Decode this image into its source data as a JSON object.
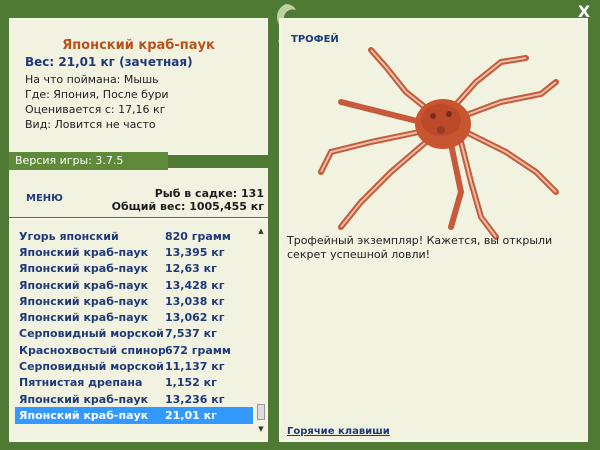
{
  "header": {
    "close_label": "X"
  },
  "catch": {
    "title": "Японский краб-паук",
    "weight_line": "Вес: 21,01 кг (зачетная)",
    "bait_line": "На что поймана: Мышь",
    "place_line": "Где: Япония, После бури",
    "value_line": "Оценивается с: 17,16 кг",
    "kind_line": "Вид: Ловится не часто"
  },
  "version": "Версия игры: 3.7.5",
  "menu": {
    "label": "МЕНЮ"
  },
  "stats": {
    "count_line": "Рыб в садке: 131",
    "total_line": "Общий вес: 1005,455 кг"
  },
  "fish_list": [
    {
      "name": "Угорь японский",
      "weight": "820 грамм"
    },
    {
      "name": "Японский краб-паук",
      "weight": "13,395 кг"
    },
    {
      "name": "Японский краб-паук",
      "weight": "12,63 кг"
    },
    {
      "name": "Японский краб-паук",
      "weight": "13,428 кг"
    },
    {
      "name": "Японский краб-паук",
      "weight": "13,038 кг"
    },
    {
      "name": "Японский краб-паук",
      "weight": "13,062 кг"
    },
    {
      "name": "Серповидный морской ...",
      "weight": "7,537 кг"
    },
    {
      "name": "Краснохвостый спинор...",
      "weight": "672 грамм"
    },
    {
      "name": "Серповидный морской ...",
      "weight": "11,137 кг"
    },
    {
      "name": "Пятнистая дрепана",
      "weight": "1,152 кг"
    },
    {
      "name": "Японский краб-паук",
      "weight": "13,236 кг"
    },
    {
      "name": "Японский краб-паук",
      "weight": "21,01 кг",
      "selected": true
    }
  ],
  "trophy": {
    "label": "ТРОФЕЙ",
    "message": "Трофейный экземпляр! Кажется, вы открыли секрет успешной ловли!",
    "hotkeys_label": "Горячие клавиши"
  }
}
